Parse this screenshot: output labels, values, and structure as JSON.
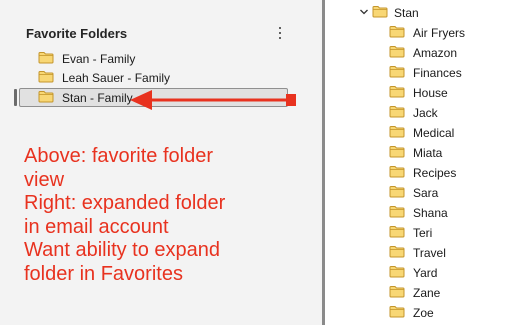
{
  "favorites": {
    "header": "Favorite Folders",
    "more_options_icon": "kebab-vertical-icon",
    "folders": [
      {
        "label": "Evan - Family"
      },
      {
        "label": "Leah Sauer - Family"
      },
      {
        "label": "Stan - Family",
        "selected": true
      }
    ]
  },
  "annotation": {
    "lines": [
      "Above: favorite folder",
      "view",
      "Right: expanded folder",
      "in email account",
      "Want ability to expand",
      "folder in Favorites"
    ],
    "color": "#e8321f"
  },
  "account_tree": {
    "root": {
      "label": "Stan",
      "expanded": true
    },
    "children": [
      {
        "label": "Air Fryers"
      },
      {
        "label": "Amazon"
      },
      {
        "label": "Finances"
      },
      {
        "label": "House"
      },
      {
        "label": "Jack"
      },
      {
        "label": "Medical"
      },
      {
        "label": "Miata"
      },
      {
        "label": "Recipes"
      },
      {
        "label": "Sara"
      },
      {
        "label": "Shana"
      },
      {
        "label": "Teri"
      },
      {
        "label": "Travel"
      },
      {
        "label": "Yard"
      },
      {
        "label": "Zane"
      },
      {
        "label": "Zoe"
      }
    ]
  },
  "colors": {
    "folder_fill": "#f8d775",
    "folder_stroke": "#c4962c",
    "arrow": "#e8321f",
    "pane_divider": "#8a8a8a"
  }
}
